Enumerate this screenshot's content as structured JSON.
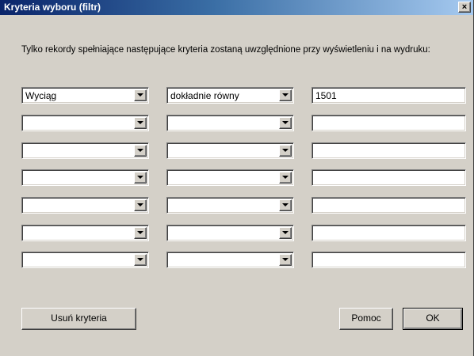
{
  "window": {
    "title": "Kryteria wyboru (filtr)",
    "close_label": "×"
  },
  "description": "Tylko rekordy spełniające następujące kryteria zostaną uwzględnione przy wyświetleniu i na wydruku:",
  "criteria": [
    {
      "field": "Wyciąg",
      "operator": "dokładnie równy",
      "value": "1501"
    },
    {
      "field": "",
      "operator": "",
      "value": ""
    },
    {
      "field": "",
      "operator": "",
      "value": ""
    },
    {
      "field": "",
      "operator": "",
      "value": ""
    },
    {
      "field": "",
      "operator": "",
      "value": ""
    },
    {
      "field": "",
      "operator": "",
      "value": ""
    },
    {
      "field": "",
      "operator": "",
      "value": ""
    }
  ],
  "buttons": {
    "remove_criteria": "Usuń kryteria",
    "help": "Pomoc",
    "ok": "OK"
  },
  "colors": {
    "title_start": "#0a246a",
    "title_end": "#a6caf0",
    "face": "#d4d0c8"
  }
}
